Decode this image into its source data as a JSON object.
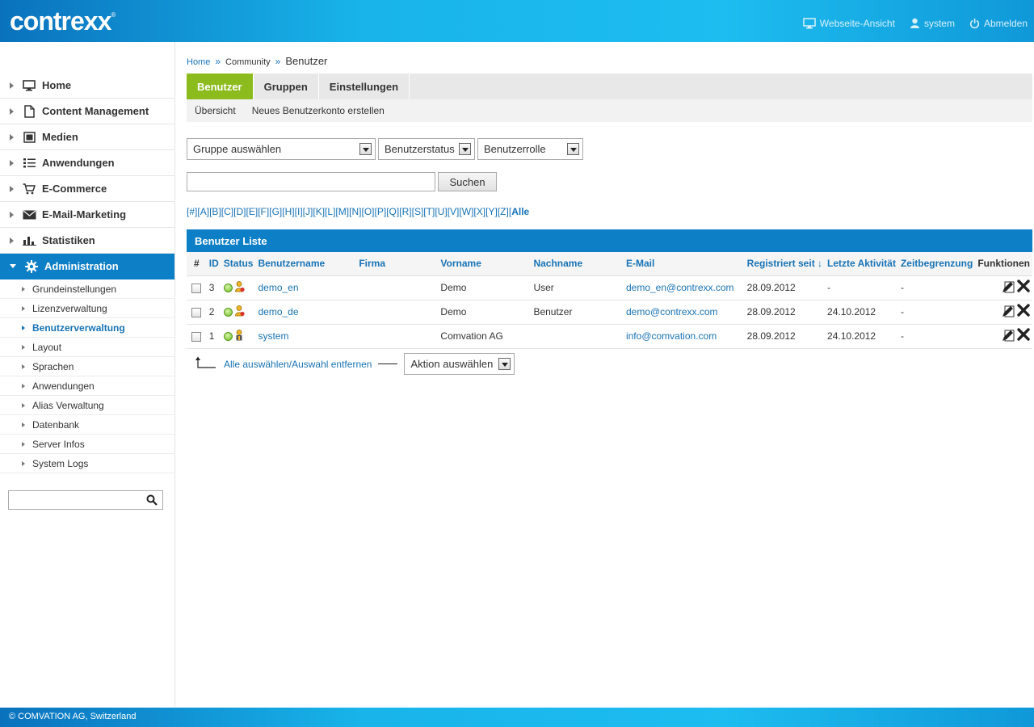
{
  "header": {
    "logo": "contrexx",
    "logo_mark": "®",
    "links": [
      {
        "label": "Webseite-Ansicht",
        "icon": "monitor-icon"
      },
      {
        "label": "system",
        "icon": "user-icon"
      },
      {
        "label": "Abmelden",
        "icon": "power-icon"
      }
    ]
  },
  "sidebar": {
    "items": [
      {
        "label": "Home",
        "icon": "monitor-icon"
      },
      {
        "label": "Content Management",
        "icon": "document-icon"
      },
      {
        "label": "Medien",
        "icon": "media-icon"
      },
      {
        "label": "Anwendungen",
        "icon": "list-icon"
      },
      {
        "label": "E-Commerce",
        "icon": "cart-icon"
      },
      {
        "label": "E-Mail-Marketing",
        "icon": "envelope-icon"
      },
      {
        "label": "Statistiken",
        "icon": "bar-chart-icon"
      },
      {
        "label": "Administration",
        "icon": "gear-icon"
      }
    ],
    "subitems": [
      "Grundeinstellungen",
      "Lizenzverwaltung",
      "Benutzerverwaltung",
      "Layout",
      "Sprachen",
      "Anwendungen",
      "Alias Verwaltung",
      "Datenbank",
      "Server Infos",
      "System Logs"
    ],
    "search_placeholder": ""
  },
  "breadcrumb": {
    "home": "Home",
    "sep": "»",
    "mid": "Community",
    "current": "Benutzer"
  },
  "tabs": [
    "Benutzer",
    "Gruppen",
    "Einstellungen"
  ],
  "subtabs": [
    "Übersicht",
    "Neues Benutzerkonto erstellen"
  ],
  "filters": {
    "group": "Gruppe auswählen",
    "status": "Benutzerstatus",
    "role": "Benutzerrolle",
    "search_value": "",
    "search_button": "Suchen"
  },
  "letters": [
    "#",
    "A",
    "B",
    "C",
    "D",
    "E",
    "F",
    "G",
    "H",
    "I",
    "J",
    "K",
    "L",
    "M",
    "N",
    "O",
    "P",
    "Q",
    "R",
    "S",
    "T",
    "U",
    "V",
    "W",
    "X",
    "Y",
    "Z",
    "Alle"
  ],
  "list": {
    "title": "Benutzer Liste",
    "columns": {
      "hash": "#",
      "id": "ID",
      "status": "Status",
      "username": "Benutzername",
      "company": "Firma",
      "firstname": "Vorname",
      "lastname": "Nachname",
      "email": "E-Mail",
      "registered": "Registriert seit ↓",
      "last_activity": "Letzte Aktivität",
      "time_limit": "Zeitbegrenzung",
      "functions": "Funktionen"
    },
    "rows": [
      {
        "id": "3",
        "username": "demo_en",
        "company": "",
        "firstname": "Demo",
        "lastname": "User",
        "email": "demo_en@contrexx.com",
        "registered": "28.09.2012",
        "last_activity": "-",
        "time_limit": "-",
        "role_icon": "user-restricted-icon"
      },
      {
        "id": "2",
        "username": "demo_de",
        "company": "",
        "firstname": "Demo",
        "lastname": "Benutzer",
        "email": "demo@contrexx.com",
        "registered": "28.09.2012",
        "last_activity": "24.10.2012",
        "time_limit": "-",
        "role_icon": "user-restricted-icon"
      },
      {
        "id": "1",
        "username": "system",
        "company": "",
        "firstname": "Comvation AG",
        "lastname": "",
        "email": "info@comvation.com",
        "registered": "28.09.2012",
        "last_activity": "24.10.2012",
        "time_limit": "-",
        "role_icon": "admin-user-icon"
      }
    ]
  },
  "bottom": {
    "select_all": "Alle auswählen",
    "sep": " / ",
    "deselect": "Auswahl entfernen",
    "action": "Aktion auswählen"
  },
  "footer": {
    "text": "© COMVATION AG, Switzerland"
  },
  "colors": {
    "header_blue": "#0d7fc6",
    "tab_green": "#8cbb1e",
    "link_blue": "#1873b6"
  }
}
